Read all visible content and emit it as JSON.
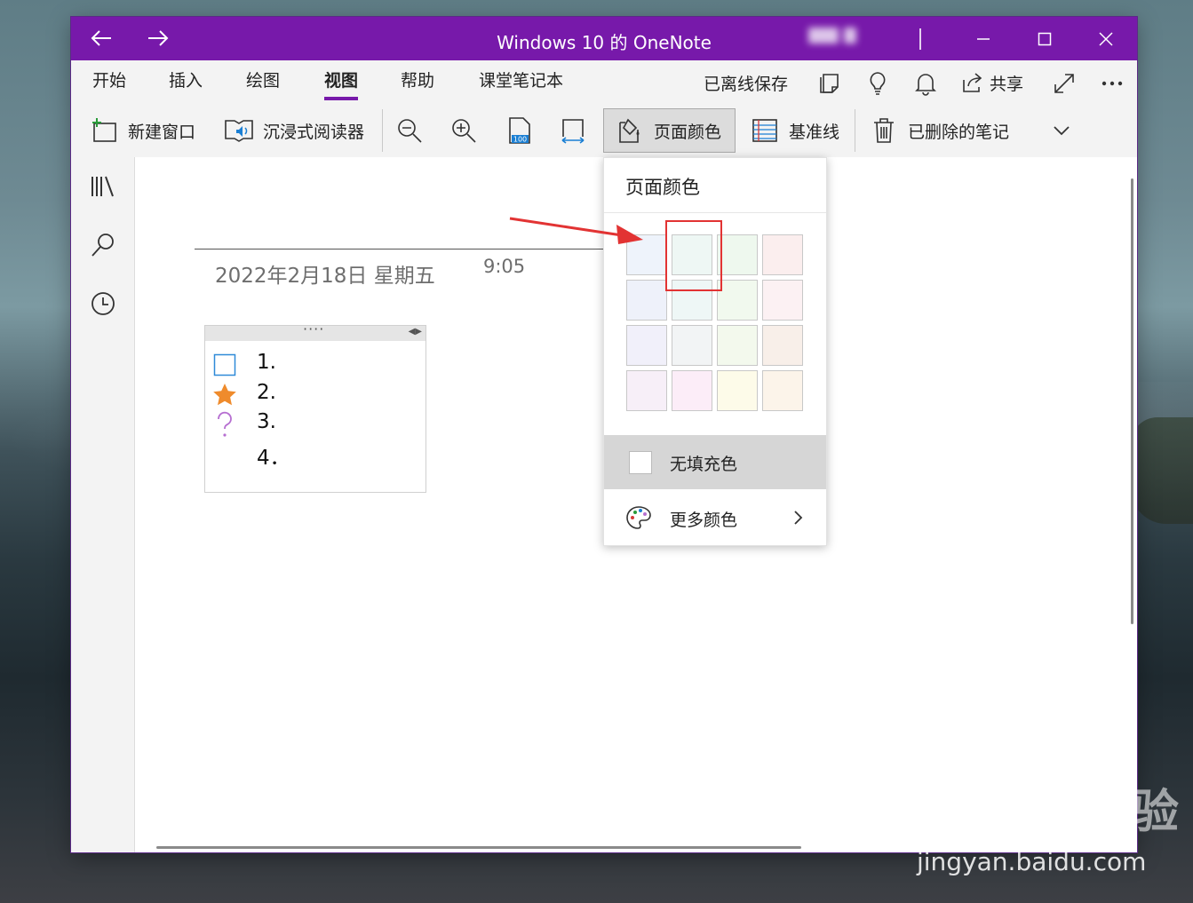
{
  "window": {
    "title": "Windows 10 的 OneNote",
    "colors": {
      "titlebar": "#7719aa",
      "accent": "#7719aa"
    }
  },
  "menu": {
    "tabs": [
      "开始",
      "插入",
      "绘图",
      "视图",
      "帮助",
      "课堂笔记本"
    ],
    "active_tab": "视图",
    "saved_status": "已离线保存",
    "share_label": "共享"
  },
  "toolbar": {
    "new_window": "新建窗口",
    "immersive_reader": "沉浸式阅读器",
    "page_color": "页面颜色",
    "rule_lines": "基准线",
    "deleted_notes": "已删除的笔记"
  },
  "page": {
    "date": "2022年2月18日 星期五",
    "time": "9:05",
    "note_items": [
      {
        "number": "1.",
        "tag": "checkbox"
      },
      {
        "number": "2.",
        "tag": "star"
      },
      {
        "number": "3.",
        "tag": "question"
      },
      {
        "number": "4．",
        "tag": "none"
      }
    ]
  },
  "page_color_menu": {
    "header": "页面颜色",
    "swatches": [
      [
        "#eef3fb",
        "#eef7f4",
        "#eef8ee",
        "#fbeeee"
      ],
      [
        "#eef1fa",
        "#eef7f6",
        "#f1f9ee",
        "#fcf1f3"
      ],
      [
        "#f1f0fa",
        "#f2f4f5",
        "#f3f9ed",
        "#f8efe9"
      ],
      [
        "#f7eff8",
        "#fcedf8",
        "#fdfbe9",
        "#fcf4ea"
      ]
    ],
    "no_fill": "无填充色",
    "more_colors": "更多颜色"
  },
  "watermark": {
    "logo": "Bai du 经验",
    "url": "jingyan.baidu.com"
  }
}
